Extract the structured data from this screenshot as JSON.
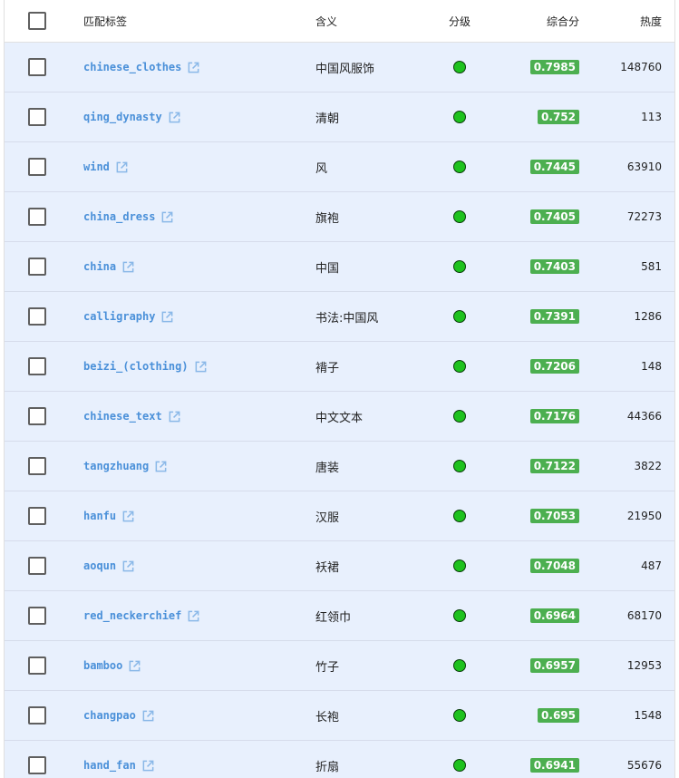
{
  "header": {
    "tag": "匹配标签",
    "meaning": "含义",
    "level": "分级",
    "score": "综合分",
    "heat": "热度"
  },
  "colors": {
    "row_bg": "#e8f0fd",
    "link": "#4a90d9",
    "badge": "#4caf50",
    "dot": "#1ec21e"
  },
  "rows": [
    {
      "tag": "chinese_clothes",
      "meaning": "中国风服饰",
      "score": "0.7985",
      "heat": "148760"
    },
    {
      "tag": "qing_dynasty",
      "meaning": "清朝",
      "score": "0.752",
      "heat": "113"
    },
    {
      "tag": "wind",
      "meaning": "风",
      "score": "0.7445",
      "heat": "63910"
    },
    {
      "tag": "china_dress",
      "meaning": "旗袍",
      "score": "0.7405",
      "heat": "72273"
    },
    {
      "tag": "china",
      "meaning": "中国",
      "score": "0.7403",
      "heat": "581"
    },
    {
      "tag": "calligraphy",
      "meaning": "书法:中国风",
      "score": "0.7391",
      "heat": "1286"
    },
    {
      "tag": "beizi_(clothing)",
      "meaning": "褙子",
      "score": "0.7206",
      "heat": "148"
    },
    {
      "tag": "chinese_text",
      "meaning": "中文文本",
      "score": "0.7176",
      "heat": "44366"
    },
    {
      "tag": "tangzhuang",
      "meaning": "唐装",
      "score": "0.7122",
      "heat": "3822"
    },
    {
      "tag": "hanfu",
      "meaning": "汉服",
      "score": "0.7053",
      "heat": "21950"
    },
    {
      "tag": "aoqun",
      "meaning": "袄裙",
      "score": "0.7048",
      "heat": "487"
    },
    {
      "tag": "red_neckerchief",
      "meaning": "红领巾",
      "score": "0.6964",
      "heat": "68170"
    },
    {
      "tag": "bamboo",
      "meaning": "竹子",
      "score": "0.6957",
      "heat": "12953"
    },
    {
      "tag": "changpao",
      "meaning": "长袍",
      "score": "0.695",
      "heat": "1548"
    },
    {
      "tag": "hand_fan",
      "meaning": "折扇",
      "score": "0.6941",
      "heat": "55676"
    }
  ]
}
